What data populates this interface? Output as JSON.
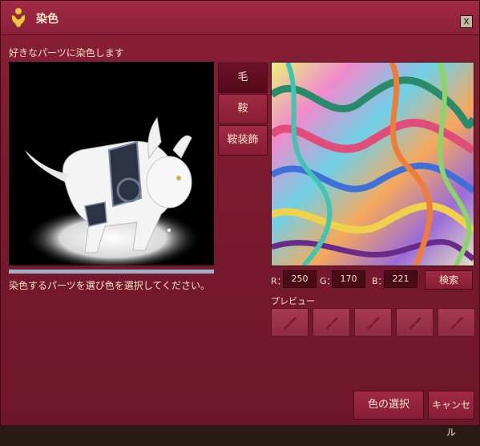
{
  "window": {
    "title": "染色",
    "close_glyph": "x",
    "subtitle": "好きなパーツに染色します",
    "hint": "染色するパーツを選び色を選択してください。"
  },
  "parts": {
    "items": [
      {
        "label": "毛",
        "selected": true
      },
      {
        "label": "鞍",
        "selected": false
      },
      {
        "label": "鞍装飾",
        "selected": false
      }
    ]
  },
  "color": {
    "r_label": "R：",
    "g_label": "G：",
    "b_label": "B：",
    "r": "250",
    "g": "170",
    "b": "221",
    "search_label": "検索"
  },
  "preview": {
    "label": "プレビュー",
    "swatch_icon": "dye-brush-icon"
  },
  "progress_fraction": 1.0,
  "buttons": {
    "select": "色の選択",
    "cancel": "キャンセル"
  }
}
